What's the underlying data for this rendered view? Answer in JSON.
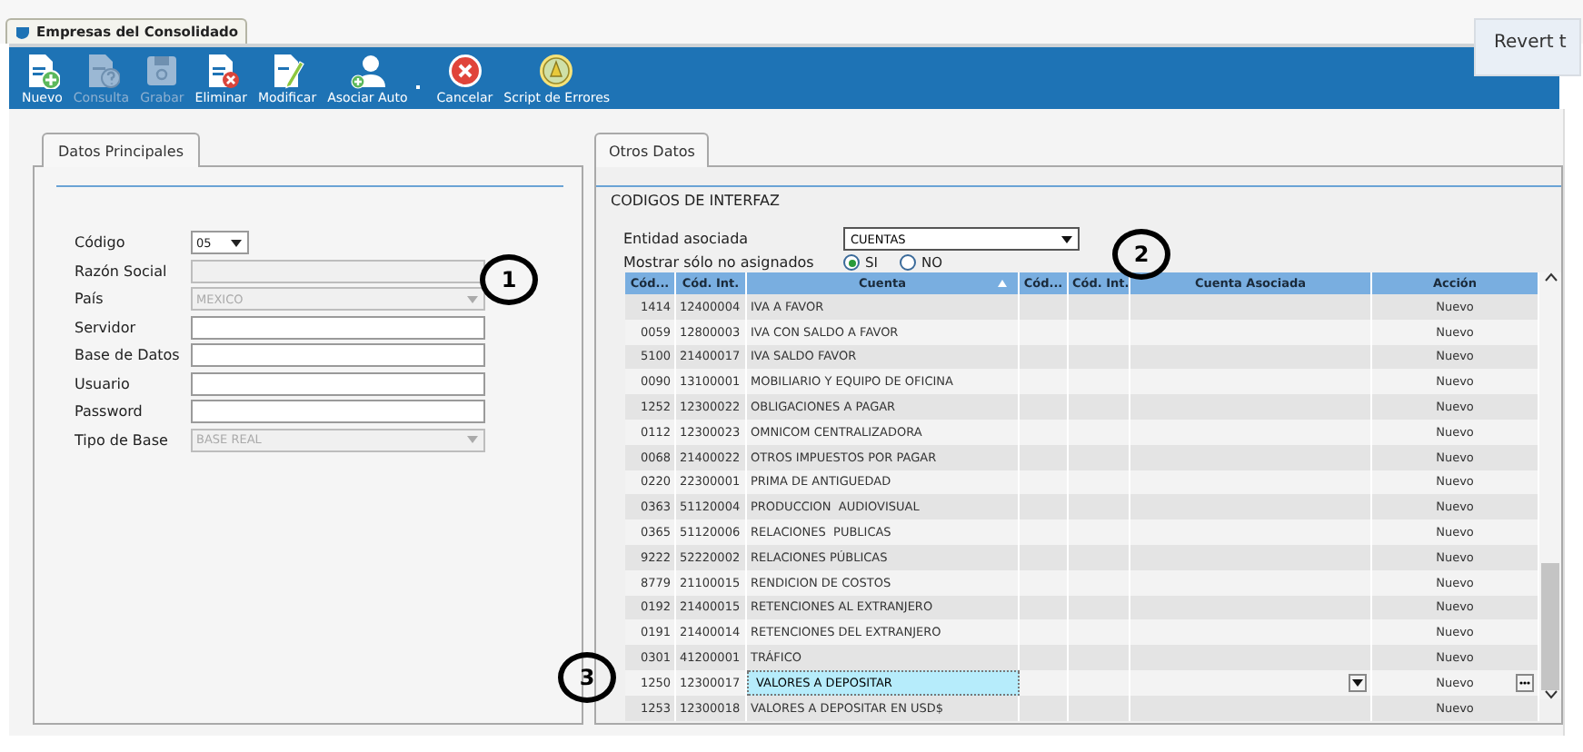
{
  "document_tab": {
    "title": "Empresas del Consolidado"
  },
  "toolbar": [
    {
      "label": "Nuevo",
      "kind": "new",
      "disabled": false
    },
    {
      "label": "Consulta",
      "kind": "query",
      "disabled": true
    },
    {
      "label": "Grabar",
      "kind": "save",
      "disabled": true
    },
    {
      "label": "Eliminar",
      "kind": "delete",
      "disabled": false
    },
    {
      "label": "Modificar",
      "kind": "edit",
      "disabled": false
    },
    {
      "label": "Asociar Auto",
      "kind": "assign",
      "disabled": false
    },
    {
      "label": "Cancelar",
      "kind": "cancel",
      "disabled": false
    },
    {
      "label": "Script de Errores",
      "kind": "script",
      "disabled": false
    }
  ],
  "popup": {
    "text": "Revert t"
  },
  "left_panel": {
    "tab": "Datos Principales",
    "fields": [
      {
        "label": "Código",
        "kind": "short-combo",
        "value": "05",
        "disabled": false
      },
      {
        "label": "Razón Social",
        "kind": "text",
        "disabled": true
      },
      {
        "label": "País",
        "kind": "combo",
        "value": "MEXICO",
        "disabled": true
      },
      {
        "label": "Servidor",
        "kind": "text",
        "disabled": false
      },
      {
        "label": "Base de Datos",
        "kind": "text",
        "disabled": false
      },
      {
        "label": "Usuario",
        "kind": "text",
        "disabled": false
      },
      {
        "label": "Password",
        "kind": "text",
        "disabled": false
      },
      {
        "label": "Tipo de Base",
        "kind": "combo",
        "value": "BASE REAL",
        "disabled": true
      }
    ]
  },
  "right_panel": {
    "tab": "Otros Datos",
    "section": "CODIGOS DE INTERFAZ",
    "entity": {
      "label": "Entidad asociada",
      "value": "CUENTAS"
    },
    "filter": {
      "label": "Mostrar sólo no asignados",
      "options": [
        {
          "label": "SI",
          "selected": true
        },
        {
          "label": "NO",
          "selected": false
        }
      ]
    },
    "table": {
      "columns": [
        {
          "label": "Cód...",
          "sorted": false
        },
        {
          "label": "Cód. Int.",
          "sorted": false
        },
        {
          "label": "Cuenta",
          "sorted": true
        },
        {
          "label": "Cód...",
          "sorted": false
        },
        {
          "label": "Cód. Int.",
          "sorted": false
        },
        {
          "label": "Cuenta Asociada",
          "sorted": false
        },
        {
          "label": "Acción",
          "sorted": false
        }
      ],
      "rows": [
        {
          "code": "1414",
          "int_code": "12400004",
          "account": "IVA A FAVOR",
          "action": "Nuevo",
          "selected": false
        },
        {
          "code": "0059",
          "int_code": "12800003",
          "account": "IVA CON SALDO A FAVOR",
          "action": "Nuevo",
          "selected": false
        },
        {
          "code": "5100",
          "int_code": "21400017",
          "account": "IVA SALDO FAVOR",
          "action": "Nuevo",
          "selected": false
        },
        {
          "code": "0090",
          "int_code": "13100001",
          "account": "MOBILIARIO Y EQUIPO DE OFICINA",
          "action": "Nuevo",
          "selected": false
        },
        {
          "code": "1252",
          "int_code": "12300022",
          "account": "OBLIGACIONES A PAGAR",
          "action": "Nuevo",
          "selected": false
        },
        {
          "code": "0112",
          "int_code": "12300023",
          "account": "OMNICOM CENTRALIZADORA",
          "action": "Nuevo",
          "selected": false
        },
        {
          "code": "0068",
          "int_code": "21400022",
          "account": "OTROS IMPUESTOS POR PAGAR",
          "action": "Nuevo",
          "selected": false
        },
        {
          "code": "0220",
          "int_code": "22300001",
          "account": "PRIMA DE ANTIGUEDAD",
          "action": "Nuevo",
          "selected": false
        },
        {
          "code": "0363",
          "int_code": "51120004",
          "account": "PRODUCCION  AUDIOVISUAL",
          "action": "Nuevo",
          "selected": false
        },
        {
          "code": "0365",
          "int_code": "51120006",
          "account": "RELACIONES  PUBLICAS",
          "action": "Nuevo",
          "selected": false
        },
        {
          "code": "9222",
          "int_code": "52220002",
          "account": "RELACIONES PÚBLICAS",
          "action": "Nuevo",
          "selected": false
        },
        {
          "code": "8779",
          "int_code": "21100015",
          "account": "RENDICION DE COSTOS",
          "action": "Nuevo",
          "selected": false
        },
        {
          "code": "0192",
          "int_code": "21400015",
          "account": "RETENCIONES AL EXTRANJERO",
          "action": "Nuevo",
          "selected": false
        },
        {
          "code": "0191",
          "int_code": "21400014",
          "account": "RETENCIONES DEL EXTRANJERO",
          "action": "Nuevo",
          "selected": false
        },
        {
          "code": "0301",
          "int_code": "41200001",
          "account": "TRÁFICO",
          "action": "Nuevo",
          "selected": false
        },
        {
          "code": "1250",
          "int_code": "12300017",
          "account": "VALORES A DEPOSITAR",
          "action": "Nuevo",
          "selected": true
        },
        {
          "code": "1253",
          "int_code": "12300018",
          "account": "VALORES A DEPOSITAR EN USD$",
          "action": "Nuevo",
          "selected": false
        }
      ]
    }
  },
  "callouts": [
    {
      "number": "1"
    },
    {
      "number": "2"
    },
    {
      "number": "3"
    }
  ]
}
